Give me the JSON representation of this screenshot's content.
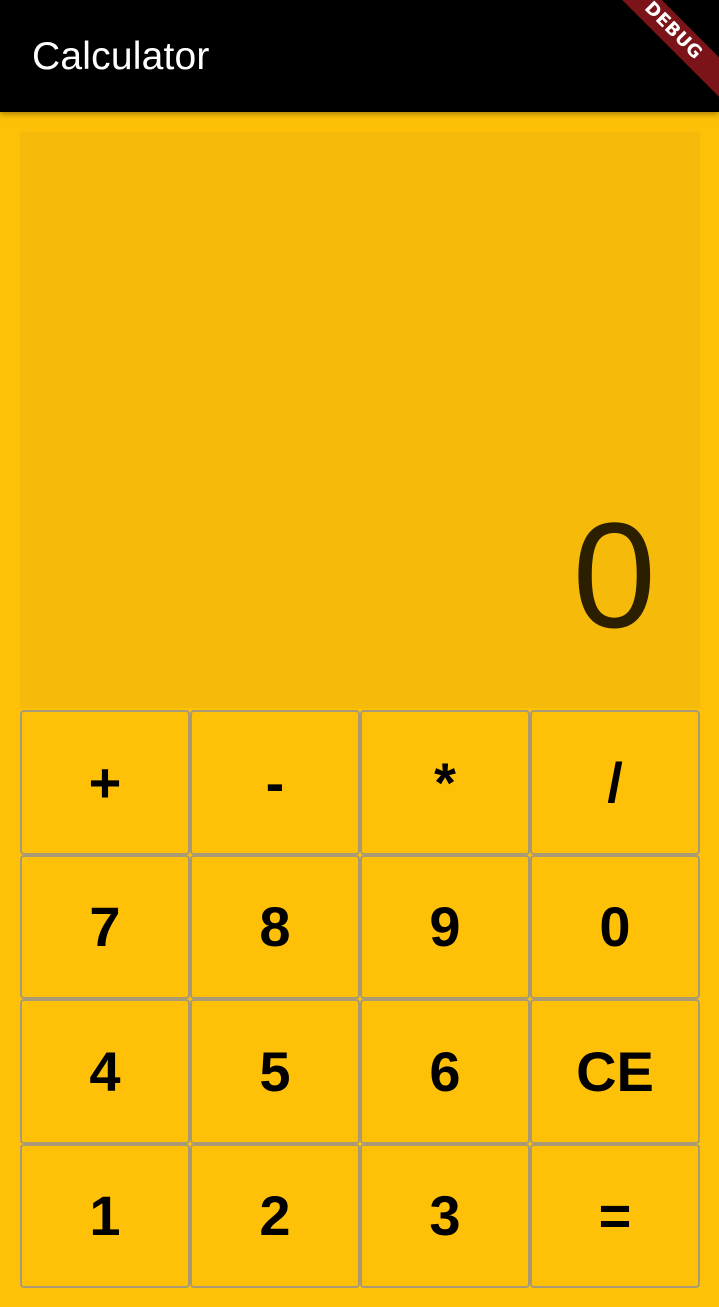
{
  "appbar": {
    "title": "Calculator",
    "debug_banner": "DEBUG"
  },
  "display": {
    "value": "0"
  },
  "keypad": {
    "rows": [
      [
        "+",
        "-",
        "*",
        "/"
      ],
      [
        "7",
        "8",
        "9",
        "0"
      ],
      [
        "4",
        "5",
        "6",
        "CE"
      ],
      [
        "1",
        "2",
        "3",
        "="
      ]
    ]
  },
  "colors": {
    "background": "#FFC107",
    "appbar": "#000000",
    "display_background": "#F5BA0A",
    "display_text": "#2B1F00",
    "key_border": "#A89A76",
    "debug_banner": "#7A1418"
  }
}
